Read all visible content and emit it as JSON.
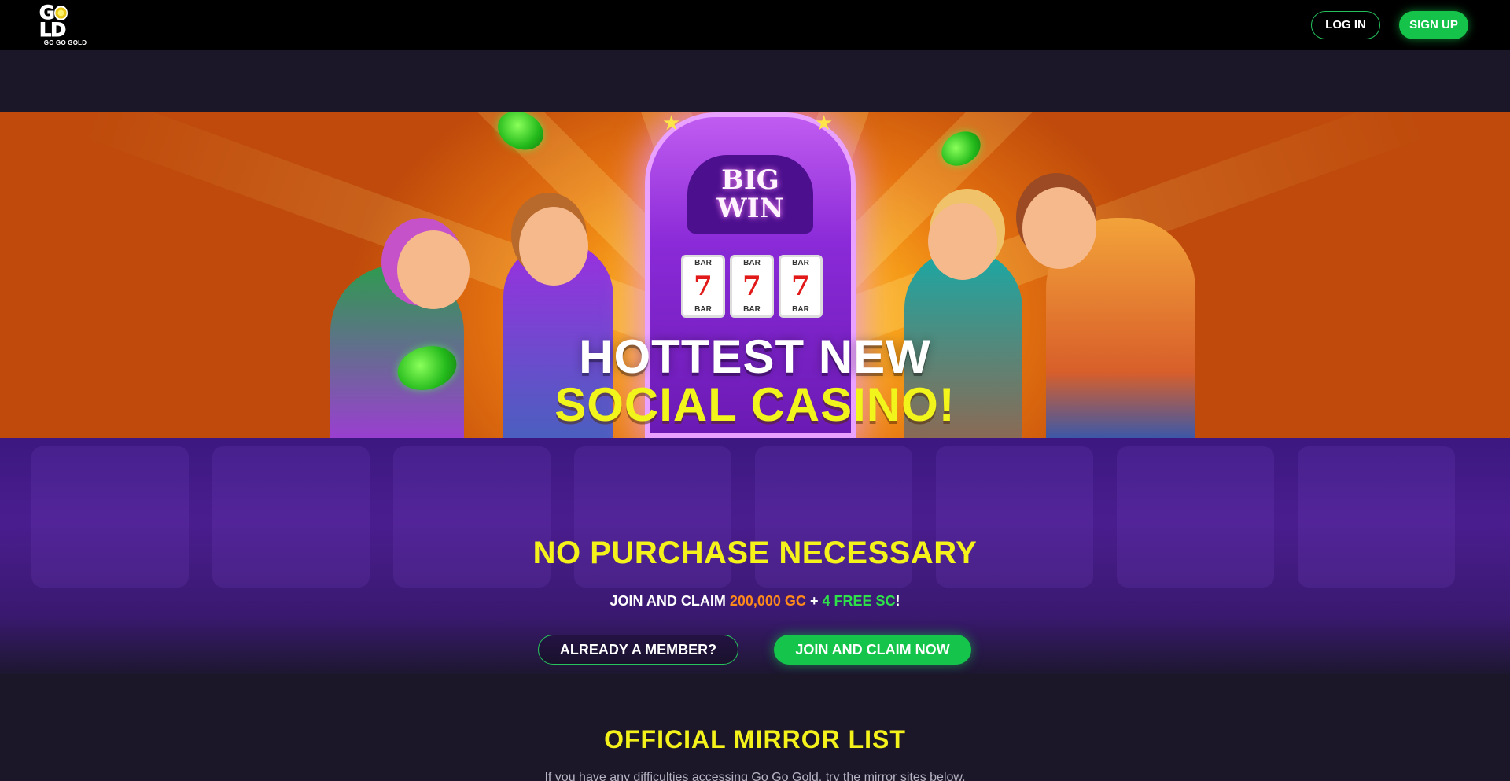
{
  "header": {
    "logo_word": "GOLD",
    "logo_sub": "GO GO GOLD",
    "login_label": "LOG IN",
    "signup_label": "SIGN UP"
  },
  "hero": {
    "machine_big": "BIG",
    "machine_win": "WIN",
    "reel_bar": "BAR",
    "reel_symbol": "7",
    "line1": "HOTTEST NEW",
    "line2": "SOCIAL CASINO!"
  },
  "promo": {
    "title": "NO PURCHASE NECESSARY",
    "sub_prefix": "JOIN AND CLAIM ",
    "gc_amount": "200,000 GC",
    "plus": " + ",
    "sc_amount": "4 FREE SC",
    "sub_suffix": "!",
    "member_button": "ALREADY A MEMBER?",
    "join_button": "JOIN AND CLAIM NOW"
  },
  "mirror": {
    "title": "OFFICIAL MIRROR LIST",
    "text": "If you have any difficulties accessing Go Go Gold, try the mirror sites below."
  },
  "colors": {
    "accent_green": "#16c34a",
    "title_yellow": "#f4f21a",
    "gc_orange": "#ff8a1c",
    "sc_green": "#2ee04a",
    "page_bg": "#1b1728"
  }
}
